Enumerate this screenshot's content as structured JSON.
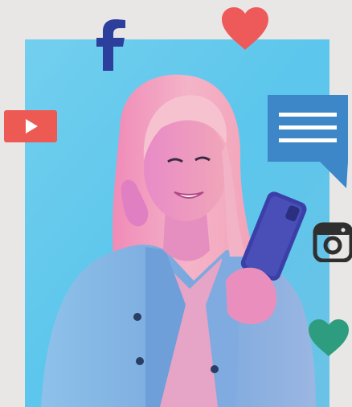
{
  "scene": {
    "background_color": "#e9e7e6",
    "photo_backdrop_color": "#5cc6ec"
  },
  "icons": [
    {
      "name": "facebook-icon",
      "color": "#2d3f9c"
    },
    {
      "name": "heart-icon",
      "color": "#ee5a5a"
    },
    {
      "name": "youtube-icon",
      "color": "#ec5a53"
    },
    {
      "name": "chat-bubble-icon",
      "color": "#3d86c8"
    },
    {
      "name": "instagram-icon",
      "color": "#2f2f2f"
    },
    {
      "name": "heart-icon",
      "color": "#2e9c7e"
    }
  ]
}
